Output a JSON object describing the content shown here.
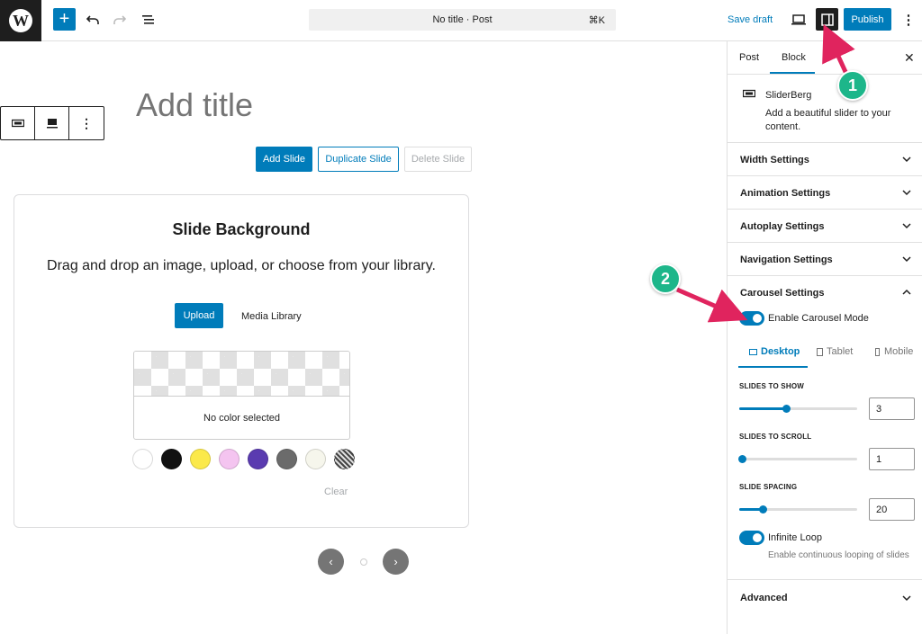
{
  "topbar": {
    "logo": "W",
    "doc_title": "No title · Post",
    "shortcut": "⌘K",
    "save_draft": "Save draft",
    "publish": "Publish",
    "icons": [
      "wordpress-icon",
      "plus-icon",
      "undo-icon",
      "redo-icon",
      "list-view-icon",
      "desktop-icon",
      "sidebar-icon",
      "more-vertical-icon"
    ]
  },
  "editor": {
    "title_placeholder": "Add title",
    "add_slide": "Add Slide",
    "duplicate_slide": "Duplicate Slide",
    "delete_slide": "Delete Slide",
    "card": {
      "heading": "Slide Background",
      "description": "Drag and drop an image, upload, or choose from your library.",
      "upload": "Upload",
      "media_library": "Media Library",
      "no_color": "No color selected",
      "clear": "Clear",
      "swatch_colors": [
        "#ffffff",
        "#111111",
        "#fbe94a",
        "#f4c4f0",
        "#5a3bb0",
        "#6b6b6b",
        "#f6f6ec",
        "checker"
      ]
    },
    "nav": {
      "prev": "‹",
      "next": "›"
    }
  },
  "sidebar": {
    "tab_post": "Post",
    "tab_block": "Block",
    "close": "✕",
    "block_name": "SliderBerg",
    "block_desc": "Add a beautiful slider to your content.",
    "panels": {
      "width": "Width Settings",
      "animation": "Animation Settings",
      "autoplay": "Autoplay Settings",
      "navigation": "Navigation Settings",
      "carousel": "Carousel Settings",
      "advanced": "Advanced"
    },
    "carousel": {
      "enable_label": "Enable Carousel Mode",
      "enabled": true,
      "devices": {
        "desktop": "Desktop",
        "tablet": "Tablet",
        "mobile": "Mobile"
      },
      "slides_to_show_label": "SLIDES TO SHOW",
      "slides_to_show": "3",
      "slides_to_show_fraction": 0.4,
      "slides_to_scroll_label": "SLIDES TO SCROLL",
      "slides_to_scroll": "1",
      "slides_to_scroll_fraction": 0.0,
      "slide_spacing_label": "SLIDE SPACING",
      "slide_spacing": "20",
      "slide_spacing_fraction": 0.2,
      "infinite_loop_label": "Infinite Loop",
      "infinite_loop_enabled": true,
      "infinite_loop_help": "Enable continuous looping of slides"
    }
  },
  "annotations": {
    "badge1": "1",
    "badge2": "2",
    "color": "#1db68a",
    "arrow_color": "#e0245e"
  },
  "colors": {
    "accent": "#007cba",
    "dark": "#1e1e1e"
  }
}
